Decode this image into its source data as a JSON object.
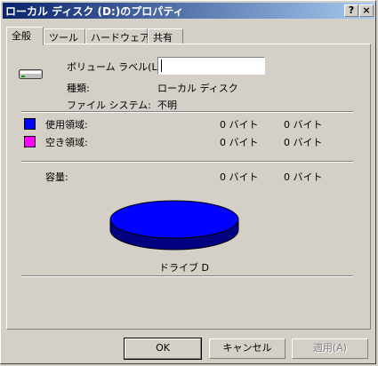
{
  "window": {
    "title": "ローカル ディスク (D:)のプロパティ",
    "help_button": "?",
    "close_button": "×"
  },
  "tabs": [
    {
      "label": "全般"
    },
    {
      "label": "ツール"
    },
    {
      "label": "ハードウェア"
    },
    {
      "label": "共有"
    }
  ],
  "general": {
    "volume_label": "ボリューム ラベル(L):",
    "volume_value": "",
    "type_label": "種類:",
    "type_value": "ローカル ディスク",
    "fs_label": "ファイル システム:",
    "fs_value": "不明",
    "used": {
      "label": "使用領域:",
      "bytes": "0 バイト",
      "size": "0 バイト",
      "color": "#0000ff"
    },
    "free": {
      "label": "空き領域:",
      "bytes": "0 バイト",
      "size": "0 バイト",
      "color": "#ff00ff"
    },
    "capacity": {
      "label": "容量:",
      "bytes": "0 バイト",
      "size": "0 バイト"
    },
    "drive_caption": "ドライブ D"
  },
  "buttons": {
    "ok": "OK",
    "cancel": "キャンセル",
    "apply": "適用(A)"
  }
}
